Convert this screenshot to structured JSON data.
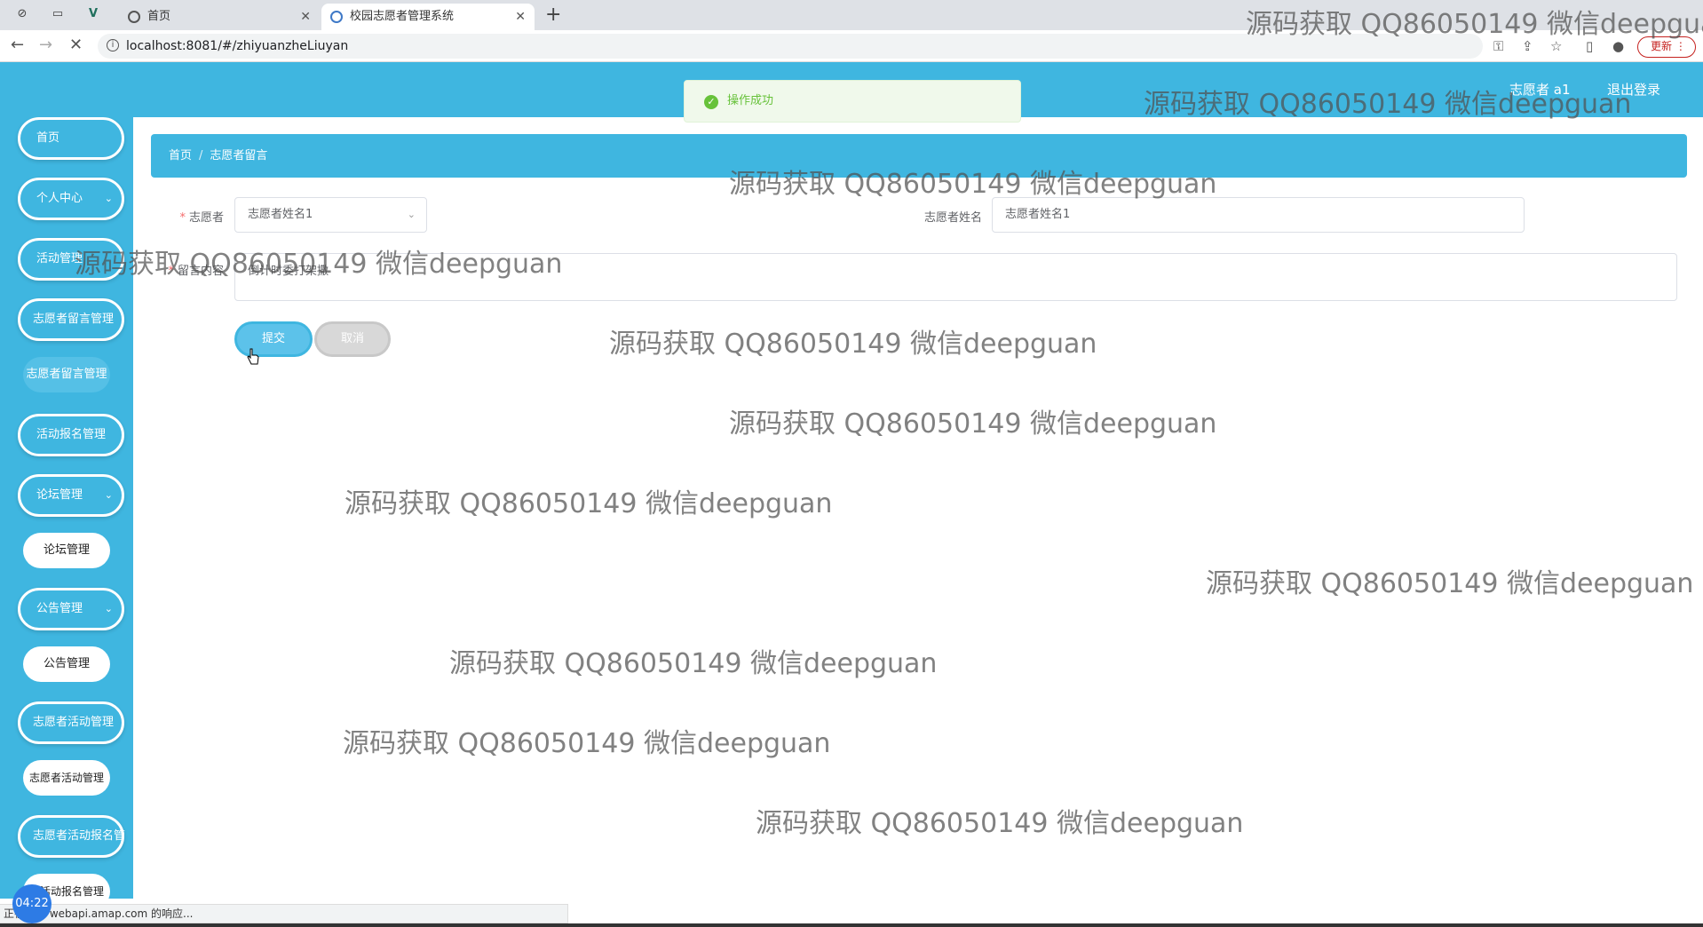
{
  "browser": {
    "tabs": [
      {
        "label": "首页",
        "active": false
      },
      {
        "label": "校园志愿者管理系统",
        "active": true
      }
    ],
    "new_tab": "+",
    "url": "localhost:8081/#/zhiyuanzheLiuyan",
    "update_label": "更新"
  },
  "header": {
    "user_label": "志愿者 a1",
    "logout_label": "退出登录"
  },
  "toast": {
    "message": "操作成功",
    "color": "#67c23a"
  },
  "sidebar": {
    "items": [
      {
        "label": "首页"
      },
      {
        "label": "个人中心"
      },
      {
        "label": "活动管理"
      },
      {
        "label": "志愿者留言管理"
      },
      {
        "label": "志愿者留言管理"
      },
      {
        "label": "活动报名管理"
      },
      {
        "label": "论坛管理"
      },
      {
        "label": "论坛管理"
      },
      {
        "label": "公告管理"
      },
      {
        "label": "公告管理"
      },
      {
        "label": "志愿者活动管理"
      },
      {
        "label": "志愿者活动管理"
      },
      {
        "label": "志愿者活动报名管"
      },
      {
        "label": "者活动报名管理"
      }
    ]
  },
  "breadcrumb": {
    "home": "首页",
    "sep": "/",
    "current": "志愿者留言"
  },
  "form": {
    "volunteer_label": "志愿者",
    "volunteer_value": "志愿者姓名1",
    "name_label": "志愿者姓名",
    "name_value": "志愿者姓名1",
    "message_label": "留言内容",
    "message_value": "倒计时委打架撒",
    "submit_label": "提交",
    "cancel_label": "取消"
  },
  "watermark_text": "源码获取 QQ86050149 微信deepguan",
  "status": {
    "text": "正在等待 webapi.amap.com 的响应...",
    "timer": "04:22"
  },
  "colors": {
    "primary": "#3fb6e0",
    "success": "#67c23a"
  }
}
